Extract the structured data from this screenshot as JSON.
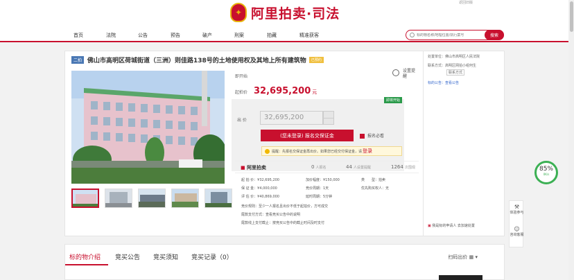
{
  "header": {
    "logo_text": "阿里拍卖·司法",
    "top_right_text": "返回旧版"
  },
  "nav": {
    "items": [
      "首页",
      "法院",
      "公告",
      "预告",
      "破产",
      "刑案",
      "拍藏",
      "精准获客"
    ]
  },
  "search": {
    "placeholder": "标的物名称/地理位置/执行案号",
    "button_label": "搜索"
  },
  "lot": {
    "tag_second": "二拍",
    "title": "佛山市高明区荷城街道（三洲）则佳路138号的土地使用权及其地上所有建筑物",
    "tag_status": "已预约",
    "status": "即开始",
    "remind_label": "设置提醒",
    "price_label": "起拍价",
    "price_value": "32,695,200",
    "price_unit": "元",
    "badge": "即将开始",
    "bid_label": "出 价",
    "bid_value": "32,695,200",
    "deposit_button": "(您未登录) 报名交保证金",
    "sign_link": "报名必看",
    "tip_text": "提醒：先报名交保证金再出价。如果您已经交付保证金，请",
    "tip_login": "登录"
  },
  "ali_stats": {
    "brand": "阿里拍卖",
    "stats": [
      {
        "num": "0",
        "label": "人报名"
      },
      {
        "num": "44",
        "label": "人设置提醒"
      },
      {
        "num": "1264",
        "label": "次围观"
      }
    ]
  },
  "details": {
    "start_price": "起 拍 价：¥32,695,200",
    "deposit": "保 证 金：¥4,000,000",
    "assess": "评 估 价：¥40,869,000",
    "increment": "加价幅度：¥150,000",
    "period": "竞价周期：1天",
    "delay": "延时周期：5分钟",
    "bid_limit": "竞 买 人 数：",
    "priority_left": "类　　型：拍卖",
    "priority": "优先购买权人：无",
    "rule1": "竞价规则：至少一人报名且出价不低于起拍价，方可成交",
    "rule2": "尾款支付方式：查看竞买公告中的说明",
    "rule3": "尾款线上支付截止：按竞买公告中的截止时间及时支付"
  },
  "side": {
    "court_label": "处置单位：佛山市高明区人民法院",
    "contact_label": "联系方式：高明区网拍小组何生",
    "contact_btn": "联系方式",
    "notice_label": "标的公告：查看公告",
    "bottom_link": "我是标的申请人 去加速处置"
  },
  "tabs": {
    "items": [
      "标的物介绍",
      "竞买公告",
      "竞买须知",
      "竞买记录（0）"
    ],
    "right_label": "扫码出价"
  },
  "gauge": {
    "percent": "85%",
    "sub": "0K/s"
  },
  "tools": {
    "items": [
      "体验参与",
      "咨询客服"
    ]
  }
}
